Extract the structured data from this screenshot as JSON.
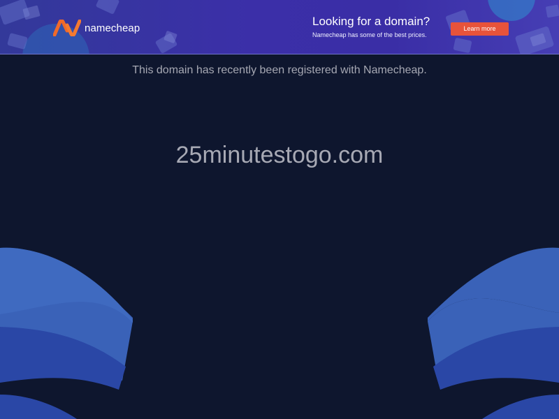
{
  "banner": {
    "logo_text": "namecheap",
    "promo_title": "Looking for a domain?",
    "promo_subtitle": "Namecheap has some of the best prices.",
    "cta_label": "Learn more"
  },
  "main": {
    "registered_message": "This domain has recently been registered with Namecheap.",
    "domain": "25minutestogo.com"
  },
  "colors": {
    "background": "#0e162e",
    "banner_gradient_start": "#33399a",
    "banner_gradient_end": "#463eb4",
    "logo_orange": "#f06a2a",
    "cta_button": "#e8533a",
    "text_muted": "#a6a8b3",
    "wave_light": "#3a62b8",
    "wave_dark": "#2a47a6"
  }
}
